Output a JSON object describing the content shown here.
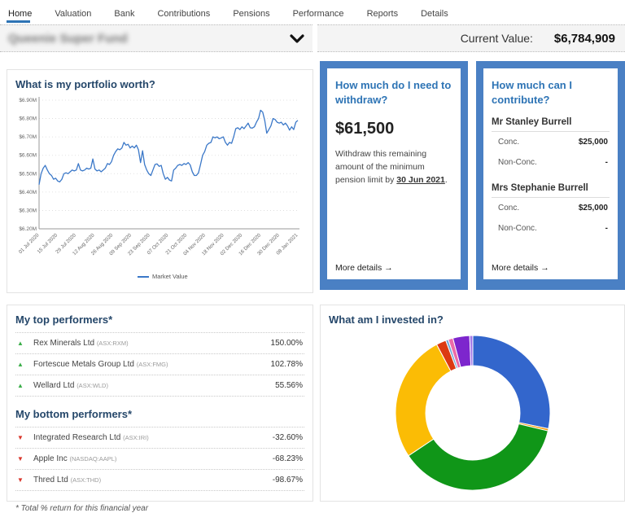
{
  "nav": {
    "items": [
      {
        "label": "Home",
        "active": true
      },
      {
        "label": "Valuation",
        "active": false
      },
      {
        "label": "Bank",
        "active": false
      },
      {
        "label": "Contributions",
        "active": false
      },
      {
        "label": "Pensions",
        "active": false
      },
      {
        "label": "Performance",
        "active": false
      },
      {
        "label": "Reports",
        "active": false
      },
      {
        "label": "Details",
        "active": false
      }
    ]
  },
  "fund_bar": {
    "fund_name": "Queenie Super Fund",
    "current_value_label": "Current Value:",
    "current_value": "$6,784,909"
  },
  "withdraw_card": {
    "title": "How much do I need to withdraw?",
    "amount": "$61,500",
    "description_prefix": "Withdraw this remaining amount of the minimum pension limit by ",
    "due_date": "30 Jun 2021",
    "description_suffix": ".",
    "more_details": "More details",
    "arrow": "→"
  },
  "contribute_card": {
    "title": "How much can I contribute?",
    "members": [
      {
        "name": "Mr Stanley Burrell",
        "rows": [
          {
            "label": "Conc.",
            "value": "$25,000"
          },
          {
            "label": "Non-Conc.",
            "value": "-"
          }
        ]
      },
      {
        "name": "Mrs Stephanie Burrell",
        "rows": [
          {
            "label": "Conc.",
            "value": "$25,000"
          },
          {
            "label": "Non-Conc.",
            "value": "-"
          }
        ]
      }
    ],
    "more_details": "More details",
    "arrow": "→"
  },
  "performers": {
    "top_title": "My top performers*",
    "bottom_title": "My bottom performers*",
    "top": [
      {
        "name": "Rex Minerals Ltd",
        "ticker": "(ASX:RXM)",
        "value": "150.00%"
      },
      {
        "name": "Fortescue Metals Group Ltd",
        "ticker": "(ASX:FMG)",
        "value": "102.78%"
      },
      {
        "name": "Wellard Ltd",
        "ticker": "(ASX:WLD)",
        "value": "55.56%"
      }
    ],
    "bottom": [
      {
        "name": "Integrated Research Ltd",
        "ticker": "(ASX:IRI)",
        "value": "-32.60%"
      },
      {
        "name": "Apple Inc",
        "ticker": "(NASDAQ:AAPL)",
        "value": "-68.23%"
      },
      {
        "name": "Thred Ltd",
        "ticker": "(ASX:THD)",
        "value": "-98.67%"
      }
    ],
    "footnote": "* Total % return for this financial year",
    "up_icon": "▲",
    "down_icon": "▼",
    "up_color": "#3cae4a",
    "down_color": "#d9362b"
  },
  "chart_data": [
    {
      "type": "line",
      "title": "What is my portfolio worth?",
      "legend": [
        "Market Value"
      ],
      "legend_position": "bottom",
      "line_color": "#3b78c8",
      "grid": true,
      "ylabel": "",
      "xlabel": "",
      "ylim": [
        6.2,
        6.9
      ],
      "y_ticks": [
        6.9,
        6.8,
        6.7,
        6.6,
        6.5,
        6.4,
        6.3,
        6.2
      ],
      "y_tick_labels": [
        "$6.90M",
        "$6.80M",
        "$6.70M",
        "$6.60M",
        "$6.50M",
        "$6.40M",
        "$6.30M",
        "$6.20M"
      ],
      "x_tick_labels": [
        "01 Jul 2020",
        "15 Jul 2020",
        "29 Jul 2020",
        "12 Aug 2020",
        "26 Aug 2020",
        "09 Sep 2020",
        "23 Sep 2020",
        "07 Oct 2020",
        "21 Oct 2020",
        "04 Nov 2020",
        "18 Nov 2020",
        "02 Dec 2020",
        "16 Dec 2020",
        "30 Dec 2020",
        "08 Jan 2021"
      ],
      "unit": "$M",
      "values": [
        6.44,
        6.5,
        6.53,
        6.545,
        6.52,
        6.5,
        6.49,
        6.47,
        6.475,
        6.46,
        6.455,
        6.47,
        6.5,
        6.505,
        6.5,
        6.51,
        6.52,
        6.515,
        6.52,
        6.555,
        6.52,
        6.515,
        6.52,
        6.53,
        6.525,
        6.53,
        6.58,
        6.525,
        6.515,
        6.52,
        6.51,
        6.52,
        6.53,
        6.555,
        6.55,
        6.565,
        6.6,
        6.62,
        6.635,
        6.63,
        6.64,
        6.67,
        6.655,
        6.66,
        6.64,
        6.65,
        6.64,
        6.655,
        6.63,
        6.56,
        6.625,
        6.55,
        6.52,
        6.5,
        6.49,
        6.52,
        6.55,
        6.553,
        6.54,
        6.545,
        6.5,
        6.47,
        6.48,
        6.465,
        6.46,
        6.52,
        6.53,
        6.545,
        6.55,
        6.545,
        6.555,
        6.55,
        6.56,
        6.548,
        6.51,
        6.49,
        6.49,
        6.505,
        6.55,
        6.6,
        6.62,
        6.655,
        6.665,
        6.67,
        6.7,
        6.695,
        6.7,
        6.69,
        6.695,
        6.7,
        6.67,
        6.655,
        6.67,
        6.665,
        6.7,
        6.745,
        6.75,
        6.74,
        6.755,
        6.745,
        6.76,
        6.775,
        6.75,
        6.748,
        6.755,
        6.78,
        6.8,
        6.845,
        6.835,
        6.79,
        6.72,
        6.74,
        6.76,
        6.8,
        6.795,
        6.78,
        6.775,
        6.78,
        6.765,
        6.775,
        6.76,
        6.737,
        6.755,
        6.74,
        6.78,
        6.79
      ]
    },
    {
      "type": "pie",
      "title": "What am I invested in?",
      "donut": true,
      "inner_radius_ratio": 0.61,
      "start_angle_deg": 0,
      "segments": [
        {
          "label": "blue",
          "percent": 28.3,
          "color": "#3366cc"
        },
        {
          "label": "orange-sliver",
          "percent": 0.45,
          "color": "#ff9900"
        },
        {
          "label": "green",
          "percent": 36.9,
          "color": "#109618"
        },
        {
          "label": "yellow",
          "percent": 26.6,
          "color": "#fbbc05"
        },
        {
          "label": "red",
          "percent": 2.05,
          "color": "#dc3912"
        },
        {
          "label": "light-blue-sliver",
          "percent": 0.55,
          "color": "#6fa8dc"
        },
        {
          "label": "pink",
          "percent": 1.0,
          "color": "#ec6ba8"
        },
        {
          "label": "purple",
          "percent": 3.5,
          "color": "#7d26cd"
        },
        {
          "label": "lavender-sliver",
          "percent": 0.65,
          "color": "#a478e8"
        }
      ]
    }
  ],
  "invested_panel": {
    "title": "What am I invested in?"
  },
  "portfolio_panel": {
    "title": "What is my portfolio worth?",
    "legend_label": "Market Value"
  }
}
